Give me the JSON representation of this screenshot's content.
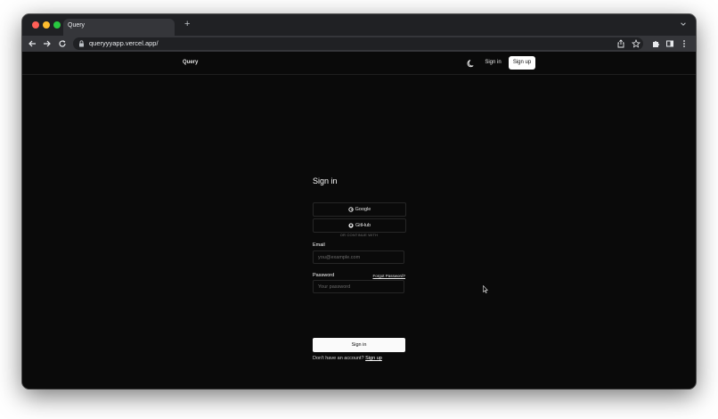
{
  "browser": {
    "tab_title": "Query",
    "new_tab_symbol": "+",
    "url": "queryyyapp.vercel.app/",
    "icons": [
      "back-icon",
      "forward-icon",
      "reload-icon",
      "lock-icon",
      "share-icon",
      "star-icon",
      "extensions-icon",
      "side-panel-icon",
      "more-icon",
      "tab-search-icon"
    ]
  },
  "header": {
    "brand": "Query",
    "theme_icon": "moon-icon",
    "sign_in": "Sign in",
    "sign_up": "Sign up"
  },
  "form": {
    "title": "Sign in",
    "google_label": "Google",
    "github_label": "GitHub",
    "divider": "OR CONTINUE WITH",
    "email_label": "Email",
    "email_placeholder": "you@example.com",
    "password_label": "Password",
    "forgot": "Forgot Password?",
    "password_placeholder": "Your password",
    "submit": "Sign in",
    "no_account": "Don't have an account?",
    "signup_link": "Sign up"
  },
  "colors": {
    "page_bg": "#0a0a0a",
    "primary_button": "#fafafa",
    "border": "#262626",
    "chrome_toolbar": "#35363a"
  }
}
